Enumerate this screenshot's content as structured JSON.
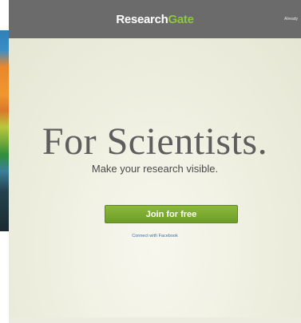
{
  "header": {
    "logo_part1": "Research",
    "logo_part2": "Gate",
    "login_text": "Already"
  },
  "hero": {
    "title": "For Scientists.",
    "subtitle": "Make your research visible.",
    "join_button_label": "Join for free",
    "connect_link": "Connect with Facebook"
  },
  "colors": {
    "header_bg": "#6b6b6b",
    "brand_green": "#8fc63f",
    "button_green": "#7aab2f",
    "hero_bg": "#eeeedf"
  }
}
